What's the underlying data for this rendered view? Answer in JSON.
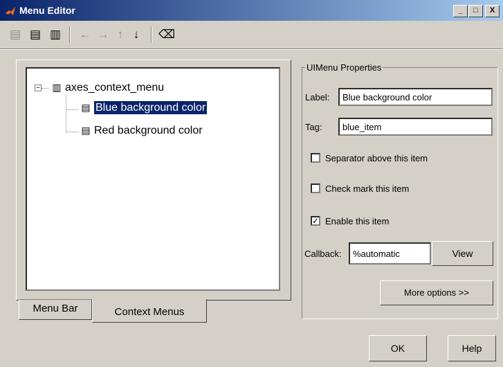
{
  "window": {
    "title": "Menu Editor",
    "title_color": "#0a246a",
    "minimize_glyph": "_",
    "maximize_glyph": "□",
    "close_glyph": "X"
  },
  "toolbar": {
    "icons": [
      "new-menu-icon",
      "new-menu-item-icon",
      "new-context-menu-icon",
      "move-left-icon",
      "move-right-icon",
      "move-up-icon",
      "move-down-icon",
      "delete-icon"
    ]
  },
  "tree": {
    "root": {
      "label": "axes_context_menu",
      "expander": "−"
    },
    "items": [
      {
        "label": "Blue background color",
        "selected": true
      },
      {
        "label": "Red background color",
        "selected": false
      }
    ],
    "selection_color": "#0a246a"
  },
  "tabs": [
    {
      "label": "Menu Bar",
      "active": false
    },
    {
      "label": "Context Menus",
      "active": true
    }
  ],
  "properties": {
    "group_title": "UIMenu Properties",
    "label_caption": "Label:",
    "label_value": "Blue background color",
    "tag_caption": "Tag:",
    "tag_value": "blue_item",
    "separator_label": "Separator above this item",
    "separator_checked": false,
    "checkmark_label": "Check mark this item",
    "checkmark_checked": false,
    "enable_label": "Enable this item",
    "enable_checked": true,
    "enable_check_glyph": "✓",
    "callback_caption": "Callback:",
    "callback_value": "%automatic",
    "view_button": "View",
    "more_options_button": "More options >>"
  },
  "footer": {
    "ok_button": "OK",
    "help_button": "Help"
  }
}
